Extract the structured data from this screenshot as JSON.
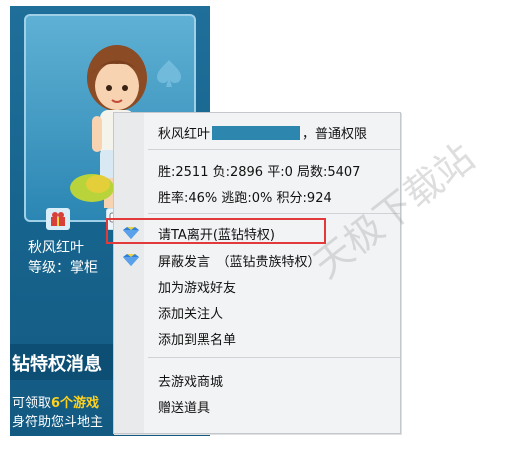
{
  "player": {
    "name": "秋风红叶",
    "level": "等级：掌柜"
  },
  "banner": {
    "title": "钻特权消息",
    "promo_prefix": "可领取",
    "promo_highlight": "6个游戏",
    "promo_line2": "身符助您斗地主"
  },
  "menu": {
    "name_prefix": "秋风红叶",
    "name_suffix": "，普通权限",
    "stats_line": "胜:2511  负:2896  平:0  局数:5407",
    "rates_line": "胜率:46%  逃跑:0%  积分:924",
    "items": [
      {
        "label": "请TA离开(蓝钻特权)",
        "icon": "blue-diamond-icon"
      },
      {
        "label": "屏蔽发言　（蓝钻贵族特权）",
        "icon": "blue-diamond-icon"
      },
      {
        "label": "加为游戏好友"
      },
      {
        "label": "添加关注人"
      },
      {
        "label": "添加到黑名单"
      },
      {
        "label": "去游戏商城"
      },
      {
        "label": "赠送道具"
      }
    ]
  },
  "watermark": "天极下载站",
  "colors": {
    "panel_bg": "#17658f",
    "highlight_border": "#e23a3a",
    "diamond": "#2f7fd6",
    "promo_highlight": "#ffd21e"
  }
}
